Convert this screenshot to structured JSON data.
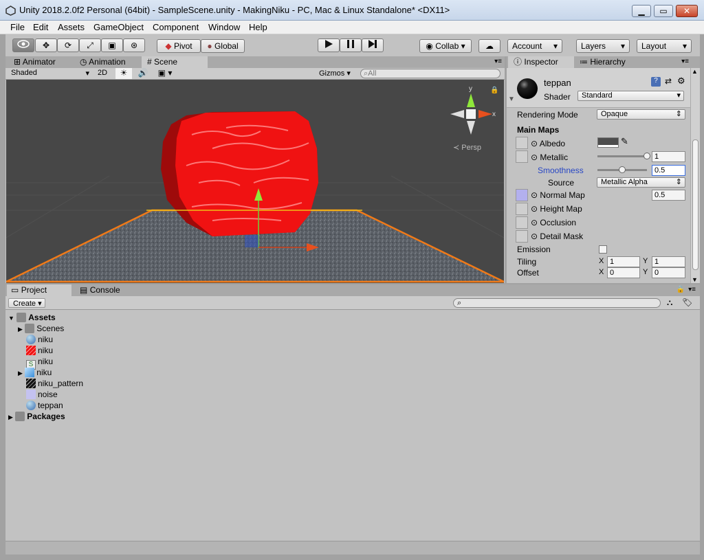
{
  "window": {
    "title": "Unity 2018.2.0f2 Personal (64bit) - SampleScene.unity - MakingNiku - PC, Mac & Linux Standalone* <DX11>",
    "min": "▁",
    "max": "▭",
    "close": "✕"
  },
  "menu": [
    "File",
    "Edit",
    "Assets",
    "GameObject",
    "Component",
    "Window",
    "Help"
  ],
  "toolbar": {
    "pivot": "Pivot",
    "global": "Global",
    "collab": "Collab ▾",
    "account": "Account",
    "layers": "Layers",
    "layout": "Layout"
  },
  "scene": {
    "tabs": [
      "Animator",
      "Animation",
      "Scene"
    ],
    "shading": "Shaded",
    "mode2d": "2D",
    "gizmos": "Gizmos",
    "search_placeholder": "All",
    "persp": "Persp",
    "axis_x": "x",
    "axis_y": "y"
  },
  "inspector": {
    "tabs": [
      "Inspector",
      "Hierarchy"
    ],
    "material_name": "teppan",
    "shader_label": "Shader",
    "shader_value": "Standard",
    "rendering_mode_label": "Rendering Mode",
    "rendering_mode_value": "Opaque",
    "main_maps": "Main Maps",
    "albedo": "Albedo",
    "metallic": "Metallic",
    "metallic_value": "1",
    "metallic_level": 1.0,
    "smoothness": "Smoothness",
    "smoothness_value": "0.5",
    "smoothness_level": 0.5,
    "source_label": "Source",
    "source_value": "Metallic Alpha",
    "normal_map": "Normal Map",
    "normal_value": "0.5",
    "height_map": "Height Map",
    "occlusion": "Occlusion",
    "detail_mask": "Detail Mask",
    "emission": "Emission",
    "tiling": "Tiling",
    "tiling_x": "1",
    "tiling_y": "1",
    "offset": "Offset",
    "offset_x": "0",
    "offset_y": "0",
    "x": "X",
    "y": "Y"
  },
  "project": {
    "tabs": [
      "Project",
      "Console"
    ],
    "create": "Create ▾",
    "tree": {
      "assets": "Assets",
      "scenes": "Scenes",
      "niku_material": "niku",
      "niku_texture": "niku",
      "niku_script": "niku",
      "niku_prefab": "niku",
      "niku_pattern": "niku_pattern",
      "noise": "noise",
      "teppan": "teppan",
      "packages": "Packages"
    }
  }
}
